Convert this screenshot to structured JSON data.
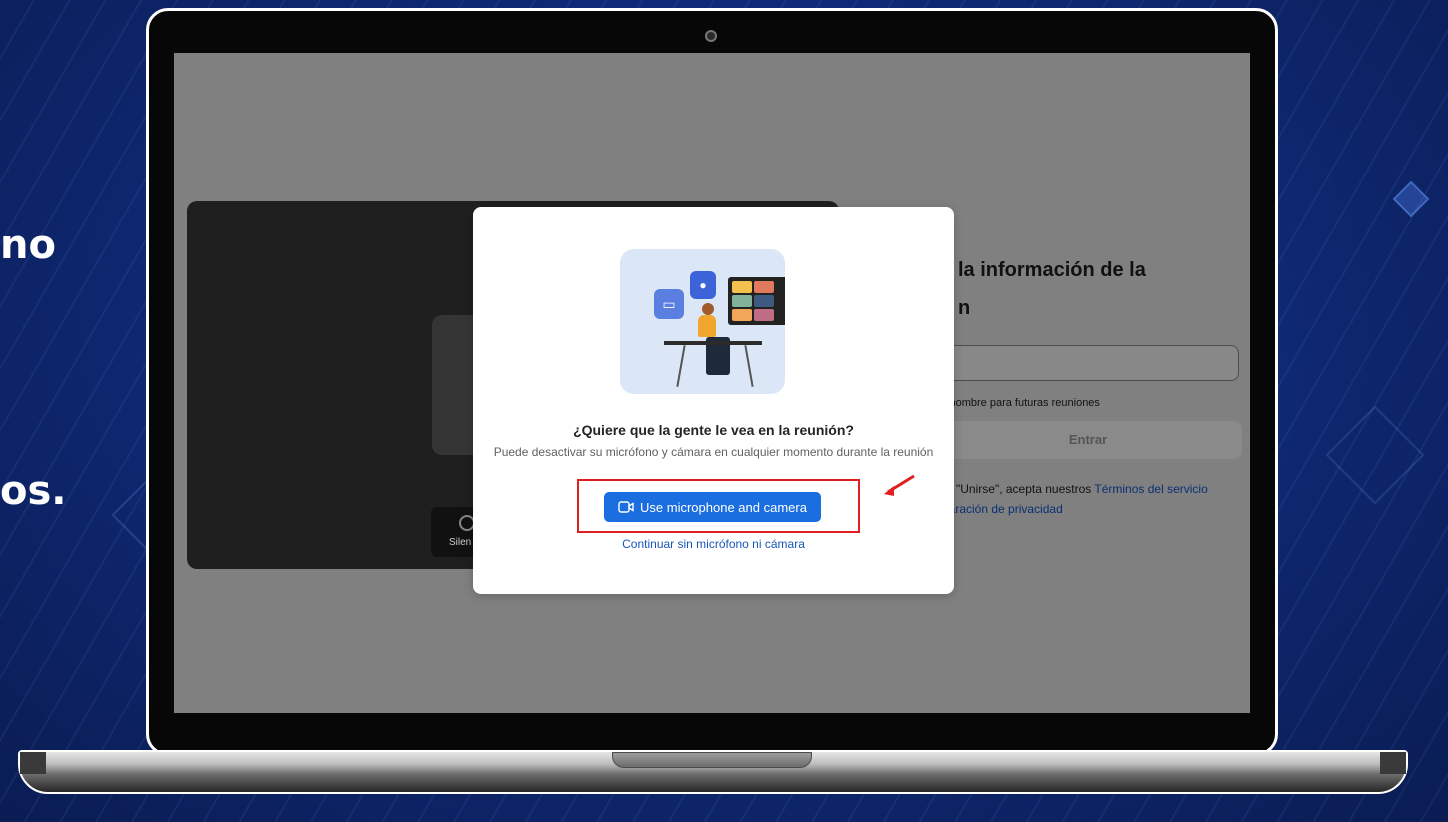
{
  "side_text": {
    "line1": "no",
    "line2": "os."
  },
  "dialog": {
    "title": "¿Quiere que la gente le vea en la reunión?",
    "description": "Puede desactivar su micrófono y cámara en cualquier momento durante la reunión",
    "primary_button": "Use microphone and camera",
    "secondary_link": "Continuar sin micrófono ni cámara"
  },
  "background_form": {
    "heading_line1": "la información de la",
    "heading_line2": "n",
    "remember_text": "i nombre para futuras reuniones",
    "join_button": "Entrar",
    "terms_prefix": "n \"Unirse\", acepta nuestros ",
    "terms_link": "Términos del servicio",
    "privacy_link": "laración de privacidad"
  },
  "video_panel": {
    "mute_label": "Silen"
  },
  "colors": {
    "primary": "#1a6ee0",
    "highlight": "#e02020",
    "background": "#0f2a78"
  },
  "icons": {
    "camera": "video-camera-icon",
    "mic": "microphone-icon",
    "arrow": "red-arrow-icon"
  }
}
